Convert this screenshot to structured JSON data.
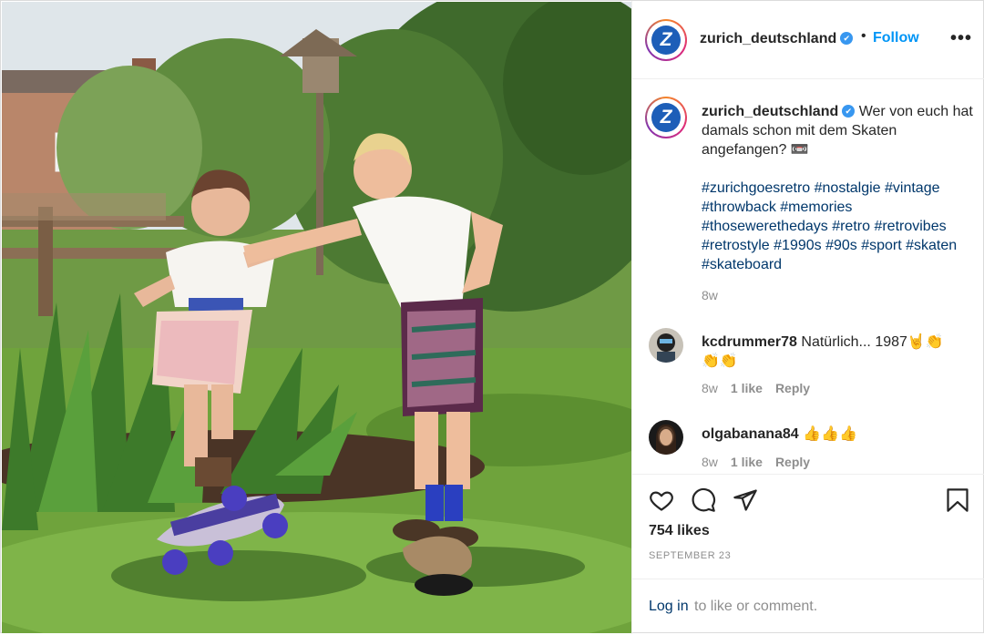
{
  "header": {
    "username": "zurich_deutschland",
    "verified_mark": "✔",
    "separator": "•",
    "follow_label": "Follow",
    "more_label": "•••"
  },
  "caption": {
    "username": "zurich_deutschland",
    "text": "Wer von euch hat damals schon mit dem Skaten angefangen? 📼",
    "hashtags": "#zurichgoesretro #nostalgie #vintage #throwback #memories #thosewerethedays #retro #retrovibes #retrostyle #1990s #90s #sport #skaten #skateboard",
    "time": "8w"
  },
  "comments": [
    {
      "username": "kcdrummer78",
      "text": "Natürlich... 1987🤘👏👏👏",
      "time": "8w",
      "likes": "1 like",
      "reply": "Reply"
    },
    {
      "username": "olgabanana84",
      "text": "👍👍👍",
      "time": "8w",
      "likes": "1 like",
      "reply": "Reply"
    }
  ],
  "actions": {
    "likes": "754 likes",
    "date": "SEPTEMBER 23",
    "login_link": "Log in",
    "login_rest": "to like or comment."
  },
  "logo_letter": "Z",
  "icons": [
    "heart-icon",
    "comment-icon",
    "share-icon",
    "bookmark-icon"
  ],
  "colors": {
    "link": "#0095f6",
    "hashtag": "#00376b",
    "muted": "#8e8e8e",
    "verified": "#3897f0",
    "zurich_blue": "#1d5eb8"
  }
}
